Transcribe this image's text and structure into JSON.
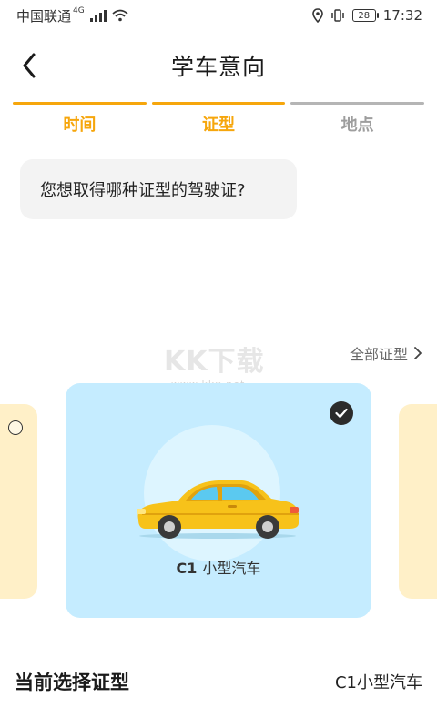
{
  "status_bar": {
    "carrier": "中国联通",
    "network": "4G",
    "battery": "28",
    "time": "17:32"
  },
  "header": {
    "title": "学车意向"
  },
  "steps": [
    {
      "label": "时间",
      "state": "completed"
    },
    {
      "label": "证型",
      "state": "active"
    },
    {
      "label": "地点",
      "state": "pending"
    }
  ],
  "question": "您想取得哪种证型的驾驶证?",
  "watermark": {
    "main": "KK下载",
    "sub": "www.kkx.net"
  },
  "all_types_link": "全部证型",
  "license_card": {
    "code": "C1",
    "name": "小型汽车",
    "selected": true
  },
  "current_selection": {
    "label": "当前选择证型",
    "value": "C1小型汽车"
  },
  "colors": {
    "accent": "#f6a60c",
    "card_selected_bg": "#c5ecff",
    "card_peek_bg": "#fff0c8",
    "car_body": "#f7c21a"
  },
  "icons": {
    "back": "chevron-left-icon",
    "signal": "signal-icon",
    "wifi": "wifi-icon",
    "location": "location-icon",
    "vibrate": "vibrate-icon",
    "battery": "battery-icon",
    "more": "chevron-right-icon",
    "check": "check-circle-icon"
  }
}
